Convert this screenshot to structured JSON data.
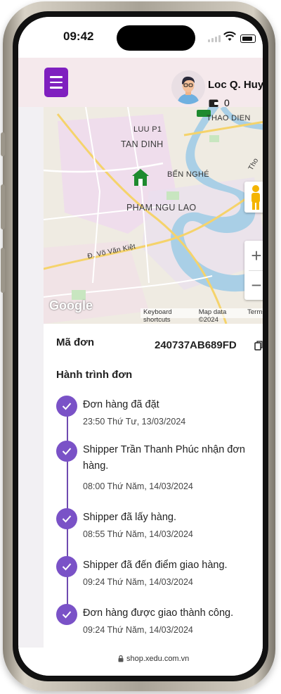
{
  "status_bar": {
    "time": "09:42"
  },
  "header": {
    "user_name": "Loc Q. Huynh",
    "wallet_balance": "0"
  },
  "map": {
    "labels": {
      "luu_p1": "LUU P1",
      "thao_dien": "THAO DIEN",
      "tan_dinh": "TAN DINH",
      "ben_nghe": "BẾN NGHÉ",
      "pham_ngu_lao": "PHAM NGU LAO",
      "vo_van_kiet": "Đ. Võ Văn Kiệt",
      "tho": "Tho"
    },
    "zoom_in": "+",
    "zoom_out": "−",
    "google": "Google",
    "attribution": {
      "shortcuts": "Keyboard shortcuts",
      "data": "Map data ©2024",
      "terms": "Terms"
    }
  },
  "order": {
    "code_label": "Mã đơn",
    "code_value": "240737AB689FD",
    "journey_title": "Hành trình đơn",
    "steps": [
      {
        "text": "Đơn hàng đã đặt",
        "datetime": "23:50 Thứ Tư, 13/03/2024"
      },
      {
        "text": "Shipper Trần Thanh Phúc nhận đơn hàng.",
        "datetime": "08:00 Thứ Năm, 14/03/2024"
      },
      {
        "text": "Shipper đã lấy hàng.",
        "datetime": "08:55 Thứ Năm, 14/03/2024"
      },
      {
        "text": "Shipper đã đến điểm giao hàng.",
        "datetime": "09:24 Thứ Năm, 14/03/2024"
      },
      {
        "text": "Đơn hàng được giao thành công.",
        "datetime": "09:24 Thứ Năm, 14/03/2024"
      }
    ]
  },
  "browser": {
    "url": "shop.xedu.com.vn"
  },
  "colors": {
    "accent": "#7f1fbf",
    "timeline": "#7a52c7",
    "header_bg": "#f5e9ec"
  }
}
